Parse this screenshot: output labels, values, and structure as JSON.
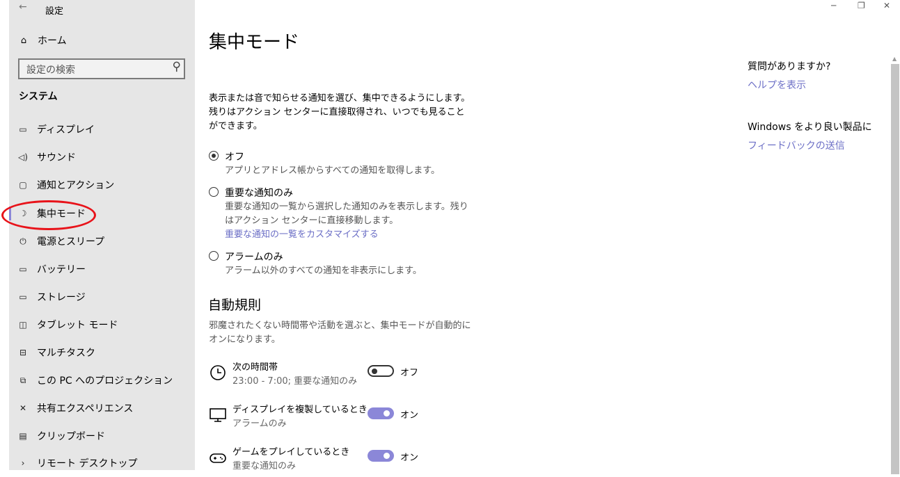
{
  "window": {
    "title": "設定",
    "minimize_icon": "─",
    "restore_icon": "❐",
    "close_icon": "✕"
  },
  "sidebar": {
    "home_label": "ホーム",
    "search_placeholder": "設定の検索",
    "section_label": "システム",
    "items": [
      {
        "label": "ディスプレイ",
        "icon": "display-icon"
      },
      {
        "label": "サウンド",
        "icon": "speaker-icon"
      },
      {
        "label": "通知とアクション",
        "icon": "notification-icon"
      },
      {
        "label": "集中モード",
        "icon": "moon-icon",
        "active": true
      },
      {
        "label": "電源とスリープ",
        "icon": "power-icon"
      },
      {
        "label": "バッテリー",
        "icon": "battery-icon"
      },
      {
        "label": "ストレージ",
        "icon": "storage-icon"
      },
      {
        "label": "タブレット モード",
        "icon": "tablet-icon"
      },
      {
        "label": "マルチタスク",
        "icon": "multitask-icon"
      },
      {
        "label": "この PC へのプロジェクション",
        "icon": "projection-icon"
      },
      {
        "label": "共有エクスペリエンス",
        "icon": "shared-icon"
      },
      {
        "label": "クリップボード",
        "icon": "clipboard-icon"
      },
      {
        "label": "リモート デスクトップ",
        "icon": "remote-desktop-icon"
      }
    ]
  },
  "main": {
    "title": "集中モード",
    "description": "表示または音で知らせる通知を選び、集中できるようにします。残りはアクション センターに直接取得され、いつでも見ることができます。",
    "options": [
      {
        "label": "オフ",
        "sub": "アプリとアドレス帳からすべての通知を取得します。",
        "checked": true
      },
      {
        "label": "重要な通知のみ",
        "sub": "重要な通知の一覧から選択した通知のみを表示します。残りはアクション センターに直接移動します。",
        "link": "重要な通知の一覧をカスタマイズする",
        "checked": false
      },
      {
        "label": "アラームのみ",
        "sub": "アラーム以外のすべての通知を非表示にします。",
        "checked": false
      }
    ],
    "auto_rules": {
      "heading": "自動規則",
      "description": "邪魔されたくない時間帯や活動を選ぶと、集中モードが自動的にオンになります。",
      "rules": [
        {
          "title": "次の時間帯",
          "sub": "23:00 - 7:00; 重要な通知のみ",
          "state": "オフ",
          "on": false,
          "icon": "clock-icon"
        },
        {
          "title": "ディスプレイを複製しているとき",
          "sub": "アラームのみ",
          "state": "オン",
          "on": true,
          "icon": "monitor-icon"
        },
        {
          "title": "ゲームをプレイしているとき",
          "sub": "重要な通知のみ",
          "state": "オン",
          "on": true,
          "icon": "gamepad-icon"
        }
      ]
    }
  },
  "right_panel": {
    "question": "質問がありますか?",
    "help_link": "ヘルプを表示",
    "feedback_heading": "Windows をより良い製品に",
    "feedback_link": "フィードバックの送信"
  },
  "colors": {
    "accent": "#8b87d8",
    "link": "#6c6fc6",
    "sidebar_bg": "#e6e6e6",
    "annotation_ring": "#e8131a"
  }
}
